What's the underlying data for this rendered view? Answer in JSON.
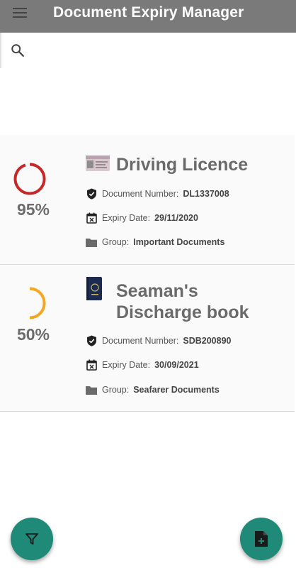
{
  "app_bar": {
    "title": "Document Expiry Manager",
    "menu_icon": "menu-icon"
  },
  "search": {
    "icon": "search-icon",
    "placeholder": ""
  },
  "documents": [
    {
      "percent": 0.95,
      "percent_label": "95%",
      "gauge_color": "#c62828",
      "title": "Driving Licence",
      "number_label": "Document Number:",
      "number": "DL1337008",
      "expiry_label": "Expiry Date:",
      "expiry": "29/11/2020",
      "group_label": "Group:",
      "group": "Important Documents"
    },
    {
      "percent": 0.5,
      "percent_label": "50%",
      "gauge_color": "#f5a623",
      "title": "Seaman's Discharge book",
      "number_label": "Document Number:",
      "number": "SDB200890",
      "expiry_label": "Expiry Date:",
      "expiry": "30/09/2021",
      "group_label": "Group:",
      "group": "Seafarer Documents"
    }
  ],
  "fabs": {
    "filter_icon": "filter-icon",
    "add_icon": "add-document-icon"
  },
  "colors": {
    "app_bar": "#7a7a7a",
    "fab": "#1f8a78"
  }
}
